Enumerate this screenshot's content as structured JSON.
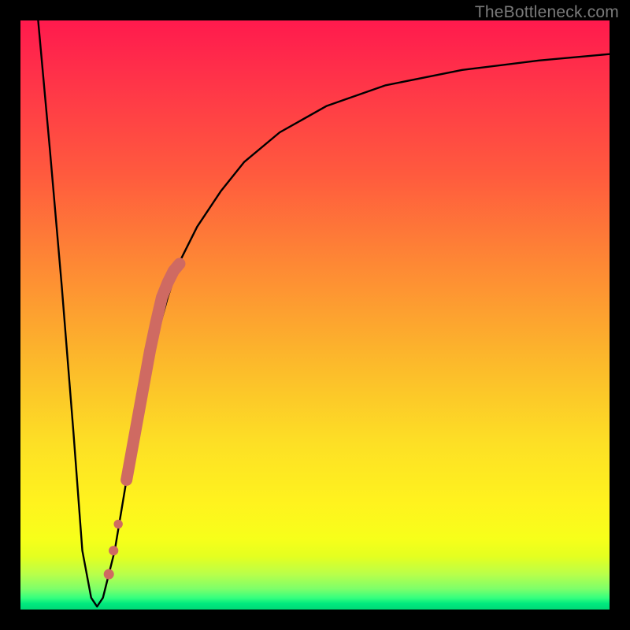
{
  "watermark": "TheBottleneck.com",
  "chart_data": {
    "type": "line",
    "title": "",
    "xlabel": "",
    "ylabel": "",
    "xlim": [
      0,
      100
    ],
    "ylim": [
      0,
      100
    ],
    "grid": false,
    "legend": false,
    "series": [
      {
        "name": "bottleneck-curve",
        "x": [
          3,
          5,
          7,
          9,
          10.5,
          12,
          13,
          14,
          16,
          18,
          20,
          22.5,
          25,
          27,
          30,
          34,
          38,
          44,
          52,
          62,
          75,
          88,
          100
        ],
        "values": [
          100,
          78,
          55,
          30,
          10,
          2,
          0.5,
          2,
          10,
          22,
          33,
          44,
          53,
          59,
          65,
          71,
          76,
          81,
          85.5,
          89,
          91.6,
          93.2,
          94.3
        ]
      }
    ],
    "markers": [
      {
        "name": "highlight-segment",
        "color": "#cf6a62",
        "x": [
          18,
          19,
          20,
          21,
          22,
          23,
          24,
          25,
          26,
          27
        ],
        "values": [
          22,
          27.5,
          33,
          38.5,
          44,
          48.7,
          53,
          55.5,
          57.5,
          58.7
        ]
      },
      {
        "name": "highlight-dots-lower",
        "color": "#cf6a62",
        "x": [
          15.0,
          15.8,
          16.6
        ],
        "values": [
          6,
          10,
          14.5
        ]
      }
    ],
    "background_gradient": {
      "top": "#ff1a4d",
      "upper_mid": "#fe8a34",
      "mid": "#fde025",
      "lower_mid": "#f7ff1a",
      "bottom": "#00d977"
    }
  }
}
